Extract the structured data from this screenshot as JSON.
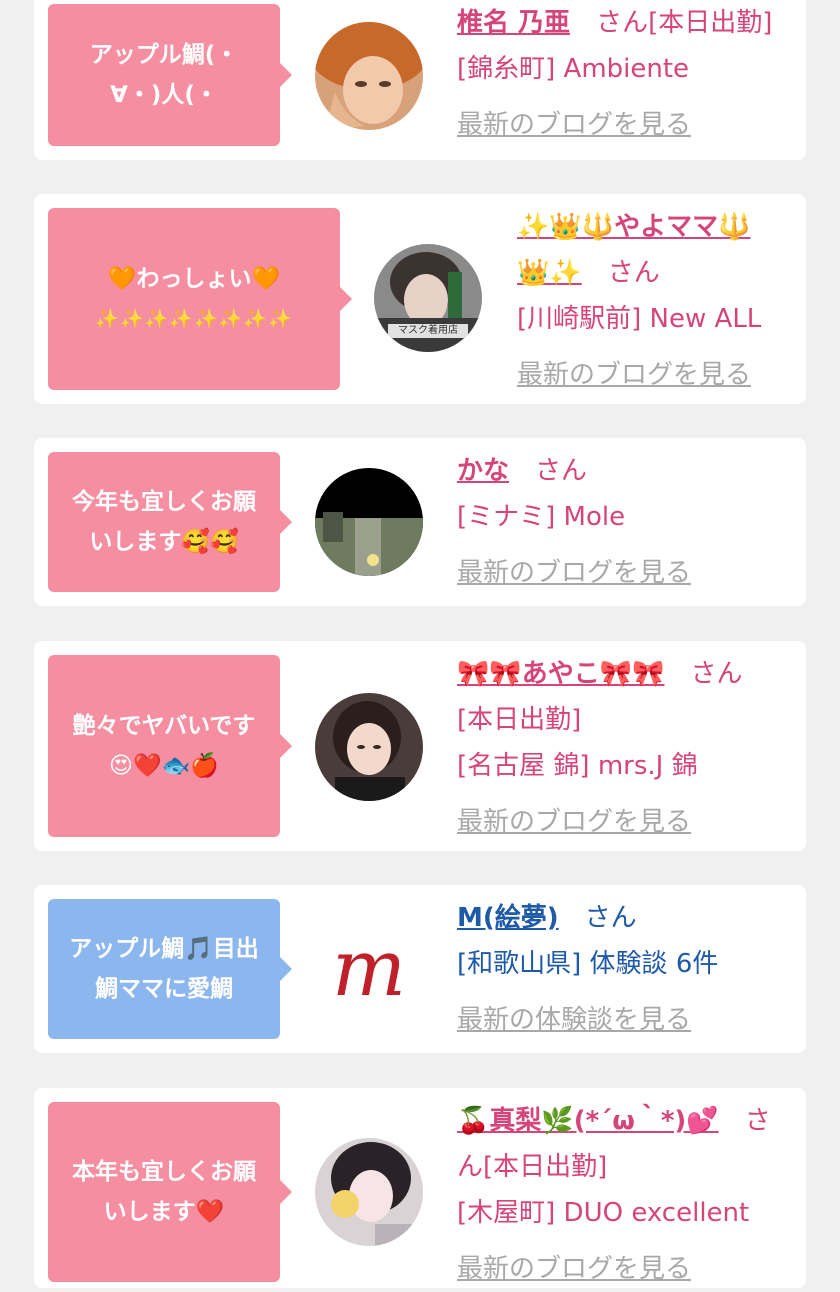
{
  "entries": [
    {
      "bubble_lines": [
        "アップル鯛(・",
        "∀・)人(・"
      ],
      "bubble_color": "#f58ea0",
      "name": "椎名 乃亜",
      "san": "さん[本日出勤]",
      "lines": [
        "[錦糸町] Ambiente"
      ],
      "more": "最新のブログを見る"
    },
    {
      "bubble_lines": [
        "🧡わっしょい🧡",
        "✨✨✨✨✨✨✨✨"
      ],
      "bubble_color": "#f58ea0",
      "name_line1": "✨👑🔱やよママ🔱",
      "name_line2": "👑✨",
      "san": "さん",
      "lines": [
        "[川崎駅前] New ALL"
      ],
      "avatar_caption": "マスク着用店",
      "more": "最新のブログを見る"
    },
    {
      "bubble_lines": [
        "今年も宜しくお願",
        "いします🥰🥰"
      ],
      "bubble_color": "#f58ea0",
      "name": "かな",
      "san": "さん",
      "lines": [
        "[ミナミ] Mole"
      ],
      "more": "最新のブログを見る"
    },
    {
      "bubble_lines": [
        "艶々でヤバいです",
        "😍❤️🐟🍎"
      ],
      "bubble_color": "#f58ea0",
      "name": "🎀🎀あやこ🎀🎀",
      "san": "さん",
      "lines": [
        "[本日出勤]",
        "[名古屋 錦] mrs.J 錦"
      ],
      "more": "最新のブログを見る"
    },
    {
      "bubble_lines": [
        "アップル鯛🎵目出",
        "鯛ママに愛鯛"
      ],
      "bubble_color": "#8cb6ee",
      "name": "M(絵夢)",
      "san": "さん",
      "lines": [
        "[和歌山県] 体験談 6件"
      ],
      "logo_letter": "m",
      "more": "最新の体験談を見る"
    },
    {
      "bubble_lines": [
        "本年も宜しくお願",
        "いします❤️"
      ],
      "bubble_color": "#f58ea0",
      "name": "🍒真梨🌿(*´ω｀*)💕",
      "san": "さ",
      "san2": "ん[本日出勤]",
      "lines": [
        "[木屋町] DUO excellent"
      ],
      "more": "最新のブログを見る"
    }
  ]
}
